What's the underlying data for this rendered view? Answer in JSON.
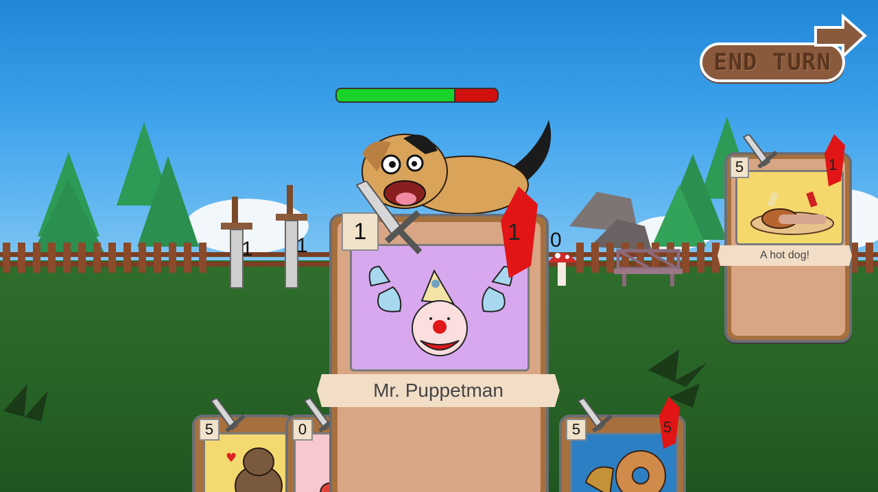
{
  "hud": {
    "end_turn_label": "END TURN",
    "enemy_health_fraction": 0.74
  },
  "field_markers": [
    {
      "value": "1"
    },
    {
      "value": "1"
    },
    {
      "value": "0"
    }
  ],
  "selected_card": {
    "attack": "1",
    "health": "1",
    "name": "Mr. Puppetman"
  },
  "enemy_card": {
    "attack": "5",
    "health": "1",
    "name": "A hot dog!"
  },
  "hand": [
    {
      "attack": "5"
    },
    {
      "attack": "0"
    },
    {
      "attack": "5",
      "health": "5"
    }
  ],
  "colors": {
    "health_green": "#19d22a",
    "health_red": "#d11010",
    "gem_red": "#e11515",
    "card_frame": "#a6703e"
  }
}
